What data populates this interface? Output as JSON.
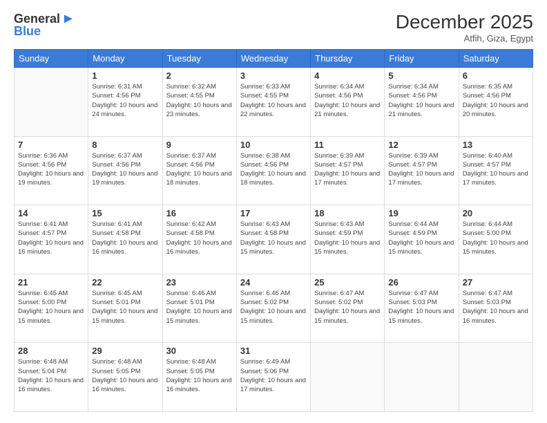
{
  "header": {
    "logo_general": "General",
    "logo_blue": "Blue",
    "month_title": "December 2025",
    "location": "Atfih, Giza, Egypt"
  },
  "weekdays": [
    "Sunday",
    "Monday",
    "Tuesday",
    "Wednesday",
    "Thursday",
    "Friday",
    "Saturday"
  ],
  "weeks": [
    [
      {
        "day": "",
        "info": ""
      },
      {
        "day": "1",
        "info": "Sunrise: 6:31 AM\nSunset: 4:56 PM\nDaylight: 10 hours and 24 minutes."
      },
      {
        "day": "2",
        "info": "Sunrise: 6:32 AM\nSunset: 4:55 PM\nDaylight: 10 hours and 23 minutes."
      },
      {
        "day": "3",
        "info": "Sunrise: 6:33 AM\nSunset: 4:55 PM\nDaylight: 10 hours and 22 minutes."
      },
      {
        "day": "4",
        "info": "Sunrise: 6:34 AM\nSunset: 4:56 PM\nDaylight: 10 hours and 21 minutes."
      },
      {
        "day": "5",
        "info": "Sunrise: 6:34 AM\nSunset: 4:56 PM\nDaylight: 10 hours and 21 minutes."
      },
      {
        "day": "6",
        "info": "Sunrise: 6:35 AM\nSunset: 4:56 PM\nDaylight: 10 hours and 20 minutes."
      }
    ],
    [
      {
        "day": "7",
        "info": "Sunrise: 6:36 AM\nSunset: 4:56 PM\nDaylight: 10 hours and 19 minutes."
      },
      {
        "day": "8",
        "info": "Sunrise: 6:37 AM\nSunset: 4:56 PM\nDaylight: 10 hours and 19 minutes."
      },
      {
        "day": "9",
        "info": "Sunrise: 6:37 AM\nSunset: 4:56 PM\nDaylight: 10 hours and 18 minutes."
      },
      {
        "day": "10",
        "info": "Sunrise: 6:38 AM\nSunset: 4:56 PM\nDaylight: 10 hours and 18 minutes."
      },
      {
        "day": "11",
        "info": "Sunrise: 6:39 AM\nSunset: 4:57 PM\nDaylight: 10 hours and 17 minutes."
      },
      {
        "day": "12",
        "info": "Sunrise: 6:39 AM\nSunset: 4:57 PM\nDaylight: 10 hours and 17 minutes."
      },
      {
        "day": "13",
        "info": "Sunrise: 6:40 AM\nSunset: 4:57 PM\nDaylight: 10 hours and 17 minutes."
      }
    ],
    [
      {
        "day": "14",
        "info": "Sunrise: 6:41 AM\nSunset: 4:57 PM\nDaylight: 10 hours and 16 minutes."
      },
      {
        "day": "15",
        "info": "Sunrise: 6:41 AM\nSunset: 4:58 PM\nDaylight: 10 hours and 16 minutes."
      },
      {
        "day": "16",
        "info": "Sunrise: 6:42 AM\nSunset: 4:58 PM\nDaylight: 10 hours and 16 minutes."
      },
      {
        "day": "17",
        "info": "Sunrise: 6:43 AM\nSunset: 4:58 PM\nDaylight: 10 hours and 15 minutes."
      },
      {
        "day": "18",
        "info": "Sunrise: 6:43 AM\nSunset: 4:59 PM\nDaylight: 10 hours and 15 minutes."
      },
      {
        "day": "19",
        "info": "Sunrise: 6:44 AM\nSunset: 4:59 PM\nDaylight: 10 hours and 15 minutes."
      },
      {
        "day": "20",
        "info": "Sunrise: 6:44 AM\nSunset: 5:00 PM\nDaylight: 10 hours and 15 minutes."
      }
    ],
    [
      {
        "day": "21",
        "info": "Sunrise: 6:45 AM\nSunset: 5:00 PM\nDaylight: 10 hours and 15 minutes."
      },
      {
        "day": "22",
        "info": "Sunrise: 6:45 AM\nSunset: 5:01 PM\nDaylight: 10 hours and 15 minutes."
      },
      {
        "day": "23",
        "info": "Sunrise: 6:46 AM\nSunset: 5:01 PM\nDaylight: 10 hours and 15 minutes."
      },
      {
        "day": "24",
        "info": "Sunrise: 6:46 AM\nSunset: 5:02 PM\nDaylight: 10 hours and 15 minutes."
      },
      {
        "day": "25",
        "info": "Sunrise: 6:47 AM\nSunset: 5:02 PM\nDaylight: 10 hours and 15 minutes."
      },
      {
        "day": "26",
        "info": "Sunrise: 6:47 AM\nSunset: 5:03 PM\nDaylight: 10 hours and 15 minutes."
      },
      {
        "day": "27",
        "info": "Sunrise: 6:47 AM\nSunset: 5:03 PM\nDaylight: 10 hours and 16 minutes."
      }
    ],
    [
      {
        "day": "28",
        "info": "Sunrise: 6:48 AM\nSunset: 5:04 PM\nDaylight: 10 hours and 16 minutes."
      },
      {
        "day": "29",
        "info": "Sunrise: 6:48 AM\nSunset: 5:05 PM\nDaylight: 10 hours and 16 minutes."
      },
      {
        "day": "30",
        "info": "Sunrise: 6:48 AM\nSunset: 5:05 PM\nDaylight: 10 hours and 16 minutes."
      },
      {
        "day": "31",
        "info": "Sunrise: 6:49 AM\nSunset: 5:06 PM\nDaylight: 10 hours and 17 minutes."
      },
      {
        "day": "",
        "info": ""
      },
      {
        "day": "",
        "info": ""
      },
      {
        "day": "",
        "info": ""
      }
    ]
  ]
}
